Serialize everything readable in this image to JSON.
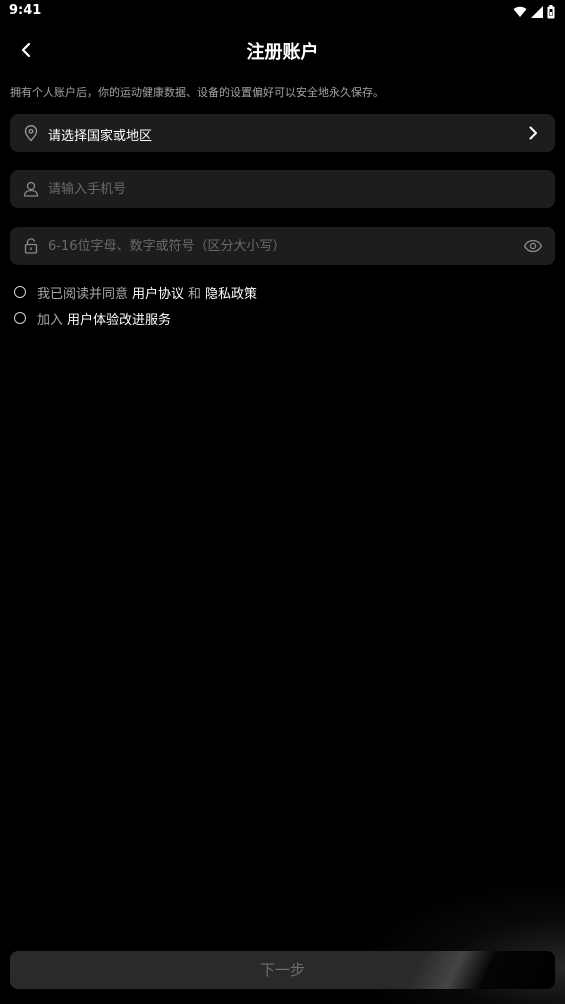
{
  "status_bar": {
    "time": "9:41",
    "icons": [
      "wifi-icon",
      "cellular-signal-icon",
      "battery-icon"
    ]
  },
  "header": {
    "title": "注册账户",
    "back_icon": "chevron-left-icon"
  },
  "hint": "拥有个人账户后，你的运动健康数据、设备的设置偏好可以安全地永久保存。",
  "region": {
    "label": "请选择国家或地区",
    "icon": "location-pin-icon",
    "chevron": "chevron-right-icon"
  },
  "phone": {
    "placeholder": "请输入手机号",
    "value": "",
    "icon": "user-icon"
  },
  "password": {
    "placeholder": "6-16位字母、数字或符号（区分大小写）",
    "value": "",
    "icon": "lock-icon",
    "toggle_icon": "eye-icon"
  },
  "agreement": {
    "prefix": "我已阅读并同意",
    "user_agreement": "用户协议",
    "and": "和",
    "privacy_policy": "隐私政策",
    "checked": false
  },
  "improvement": {
    "prefix": "加入",
    "program": "用户体验改进服务",
    "checked": false
  },
  "next_button": {
    "label": "下一步",
    "enabled": false
  },
  "colors": {
    "background": "#000000",
    "field": "#1d1d1d",
    "button_disabled": "#2a2a2a",
    "text_muted": "#a8a8a8"
  }
}
